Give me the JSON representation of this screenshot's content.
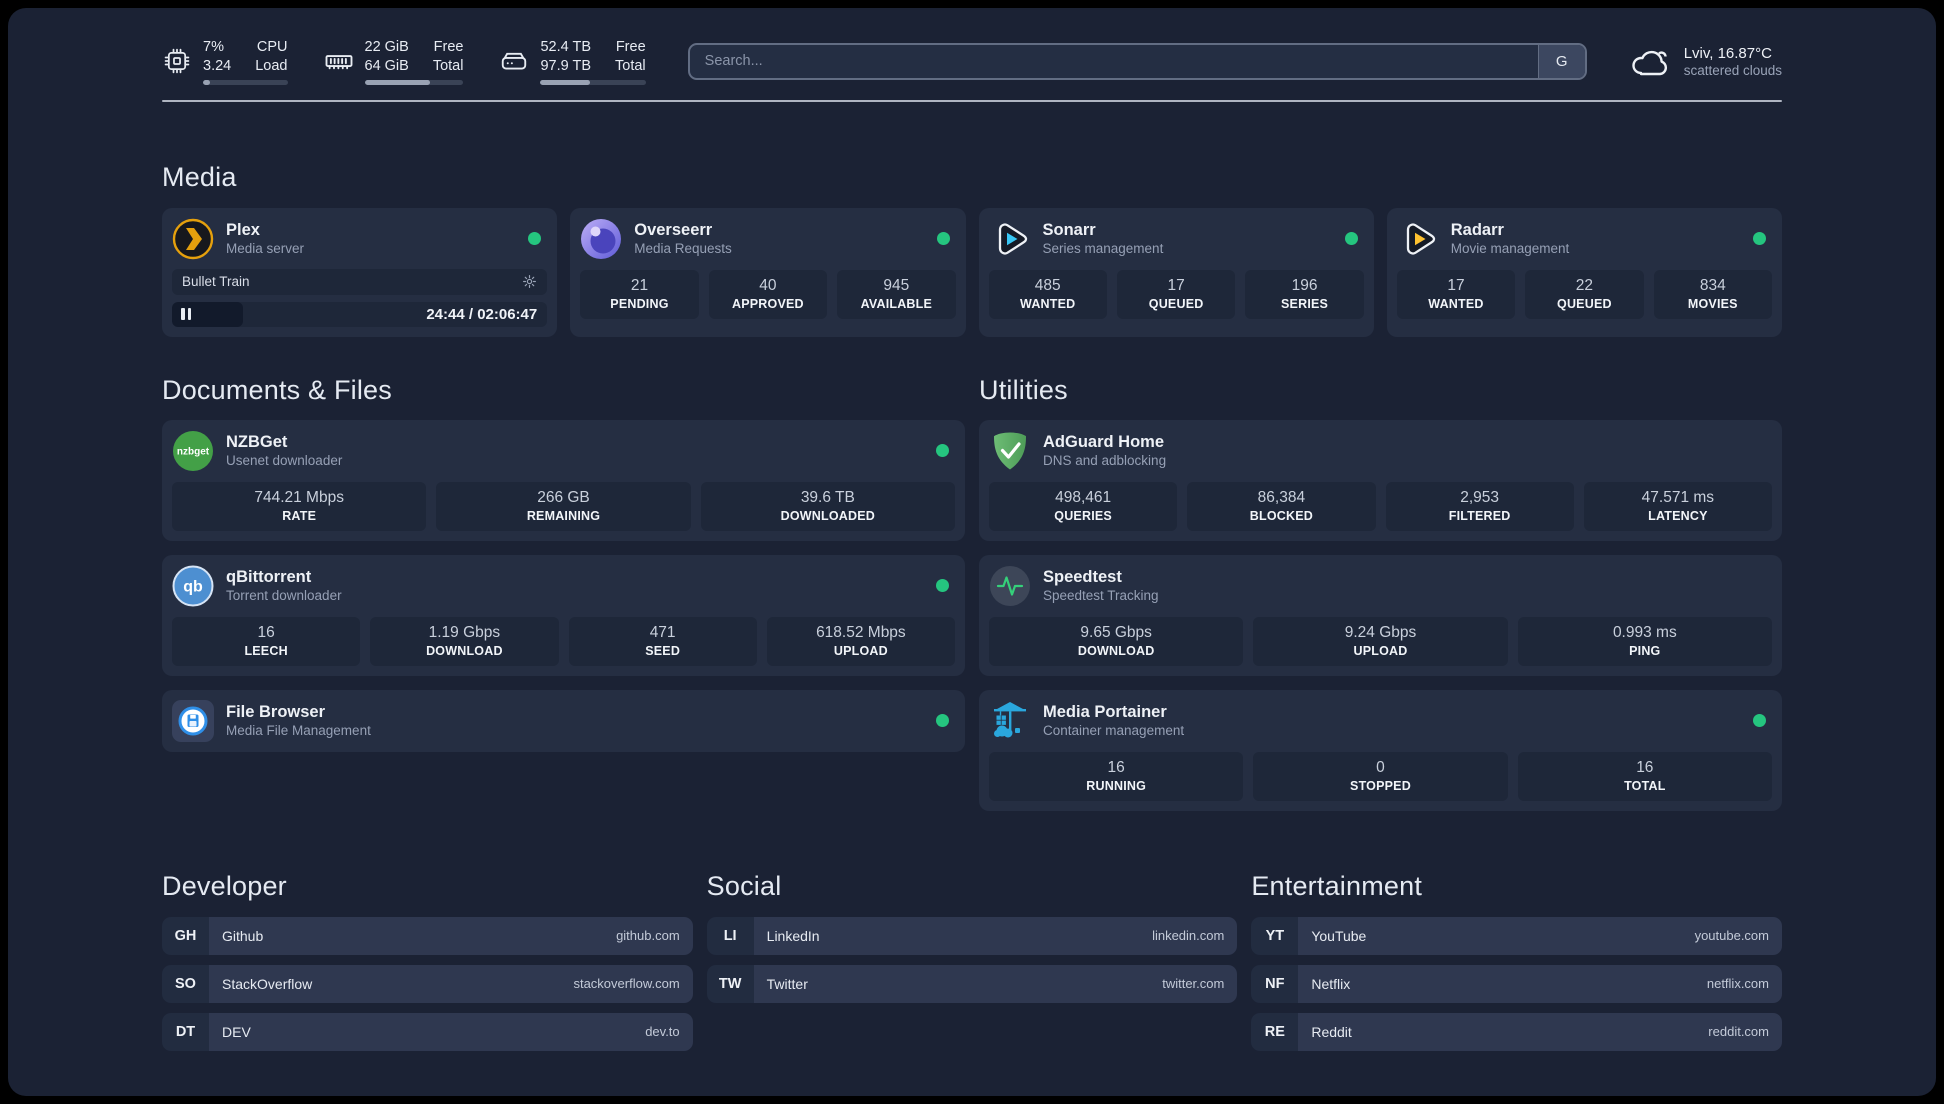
{
  "header": {
    "resources": [
      {
        "icon": "cpu-icon",
        "value1": "7%",
        "value2": "3.24",
        "label1": "CPU",
        "label2": "Load",
        "progress": 8
      },
      {
        "icon": "memory-icon",
        "value1": "22 GiB",
        "value2": "64 GiB",
        "label1": "Free",
        "label2": "Total",
        "progress": 66
      },
      {
        "icon": "disk-icon",
        "value1": "52.4 TB",
        "value2": "97.9 TB",
        "label1": "Free",
        "label2": "Total",
        "progress": 47
      }
    ],
    "search": {
      "placeholder": "Search...",
      "button_label": "G"
    },
    "weather": {
      "line1": "Lviv, 16.87°C",
      "line2": "scattered clouds"
    }
  },
  "sections": {
    "media": {
      "title": "Media",
      "plex": {
        "name": "Plex",
        "description": "Media server",
        "online": true,
        "player": {
          "title": "Bullet Train",
          "time": "24:44 / 02:06:47",
          "progress_pct": 19
        }
      },
      "overseerr": {
        "name": "Overseerr",
        "description": "Media Requests",
        "online": true,
        "stats": [
          {
            "value": "21",
            "label": "PENDING"
          },
          {
            "value": "40",
            "label": "APPROVED"
          },
          {
            "value": "945",
            "label": "AVAILABLE"
          }
        ]
      },
      "sonarr": {
        "name": "Sonarr",
        "description": "Series management",
        "online": true,
        "stats": [
          {
            "value": "485",
            "label": "WANTED"
          },
          {
            "value": "17",
            "label": "QUEUED"
          },
          {
            "value": "196",
            "label": "SERIES"
          }
        ]
      },
      "radarr": {
        "name": "Radarr",
        "description": "Movie management",
        "online": true,
        "stats": [
          {
            "value": "17",
            "label": "WANTED"
          },
          {
            "value": "22",
            "label": "QUEUED"
          },
          {
            "value": "834",
            "label": "MOVIES"
          }
        ]
      }
    },
    "documents": {
      "title": "Documents & Files",
      "nzbget": {
        "name": "NZBGet",
        "description": "Usenet downloader",
        "online": true,
        "stats": [
          {
            "value": "744.21 Mbps",
            "label": "RATE"
          },
          {
            "value": "266 GB",
            "label": "REMAINING"
          },
          {
            "value": "39.6 TB",
            "label": "DOWNLOADED"
          }
        ]
      },
      "qbittorrent": {
        "name": "qBittorrent",
        "description": "Torrent downloader",
        "online": true,
        "stats": [
          {
            "value": "16",
            "label": "LEECH"
          },
          {
            "value": "1.19 Gbps",
            "label": "DOWNLOAD"
          },
          {
            "value": "471",
            "label": "SEED"
          },
          {
            "value": "618.52 Mbps",
            "label": "UPLOAD"
          }
        ]
      },
      "filebrowser": {
        "name": "File Browser",
        "description": "Media File Management",
        "online": true
      }
    },
    "utilities": {
      "title": "Utilities",
      "adguard": {
        "name": "AdGuard Home",
        "description": "DNS and adblocking",
        "stats": [
          {
            "value": "498,461",
            "label": "QUERIES"
          },
          {
            "value": "86,384",
            "label": "BLOCKED"
          },
          {
            "value": "2,953",
            "label": "FILTERED"
          },
          {
            "value": "47.571 ms",
            "label": "LATENCY"
          }
        ]
      },
      "speedtest": {
        "name": "Speedtest",
        "description": "Speedtest Tracking",
        "stats": [
          {
            "value": "9.65 Gbps",
            "label": "DOWNLOAD"
          },
          {
            "value": "9.24 Gbps",
            "label": "UPLOAD"
          },
          {
            "value": "0.993 ms",
            "label": "PING"
          }
        ]
      },
      "portainer": {
        "name": "Media Portainer",
        "description": "Container management",
        "online": true,
        "stats": [
          {
            "value": "16",
            "label": "RUNNING"
          },
          {
            "value": "0",
            "label": "STOPPED"
          },
          {
            "value": "16",
            "label": "TOTAL"
          }
        ]
      }
    },
    "bookmarks": [
      {
        "title": "Developer",
        "links": [
          {
            "abbr": "GH",
            "name": "Github",
            "domain": "github.com"
          },
          {
            "abbr": "SO",
            "name": "StackOverflow",
            "domain": "stackoverflow.com"
          },
          {
            "abbr": "DT",
            "name": "DEV",
            "domain": "dev.to"
          }
        ]
      },
      {
        "title": "Social",
        "links": [
          {
            "abbr": "LI",
            "name": "LinkedIn",
            "domain": "linkedin.com"
          },
          {
            "abbr": "TW",
            "name": "Twitter",
            "domain": "twitter.com"
          }
        ]
      },
      {
        "title": "Entertainment",
        "links": [
          {
            "abbr": "YT",
            "name": "YouTube",
            "domain": "youtube.com"
          },
          {
            "abbr": "NF",
            "name": "Netflix",
            "domain": "netflix.com"
          },
          {
            "abbr": "RE",
            "name": "Reddit",
            "domain": "reddit.com"
          }
        ]
      }
    ]
  },
  "colors": {
    "page_bg": "#1b2234",
    "card_bg": "#252e42",
    "stat_bg": "#1e2739",
    "status_online": "#25c57f",
    "plex_gold": "#e5a00d",
    "sonarr_blue": "#38c6f4",
    "radarr_gold": "#ffc230",
    "nzbget_green": "#43a047",
    "qbittorrent_blue": "#4d8fd1",
    "adguard_green": "#5fae68",
    "speedtest_green": "#35d07a",
    "portainer_blue": "#2aa7dd"
  }
}
